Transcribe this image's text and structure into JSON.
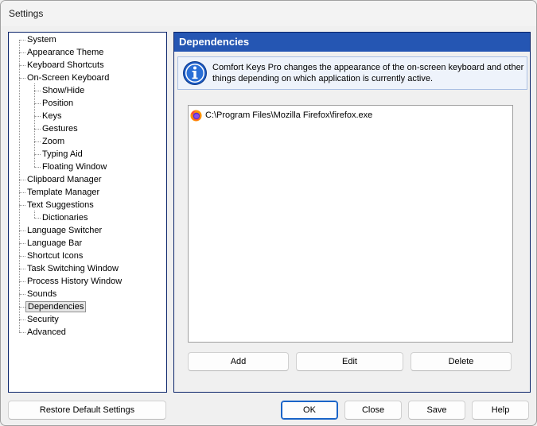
{
  "window": {
    "title": "Settings"
  },
  "tree": {
    "items": [
      {
        "label": "System",
        "level": 0
      },
      {
        "label": "Appearance Theme",
        "level": 0
      },
      {
        "label": "Keyboard Shortcuts",
        "level": 0
      },
      {
        "label": "On-Screen Keyboard",
        "level": 0
      },
      {
        "label": "Show/Hide",
        "level": 1
      },
      {
        "label": "Position",
        "level": 1
      },
      {
        "label": "Keys",
        "level": 1
      },
      {
        "label": "Gestures",
        "level": 1
      },
      {
        "label": "Zoom",
        "level": 1
      },
      {
        "label": "Typing Aid",
        "level": 1
      },
      {
        "label": "Floating Window",
        "level": 1
      },
      {
        "label": "Clipboard Manager",
        "level": 0
      },
      {
        "label": "Template Manager",
        "level": 0
      },
      {
        "label": "Text Suggestions",
        "level": 0
      },
      {
        "label": "Dictionaries",
        "level": 1
      },
      {
        "label": "Language Switcher",
        "level": 0
      },
      {
        "label": "Language Bar",
        "level": 0
      },
      {
        "label": "Shortcut Icons",
        "level": 0
      },
      {
        "label": "Task Switching Window",
        "level": 0
      },
      {
        "label": "Process History Window",
        "level": 0
      },
      {
        "label": "Sounds",
        "level": 0
      },
      {
        "label": "Dependencies",
        "level": 0,
        "selected": true
      },
      {
        "label": "Security",
        "level": 0
      },
      {
        "label": "Advanced",
        "level": 0
      }
    ]
  },
  "panel": {
    "header": "Dependencies",
    "info_text": "Comfort Keys Pro changes the appearance of the on-screen keyboard and other things depending on which application is currently active.",
    "list_items": [
      {
        "icon": "firefox-icon",
        "path": "C:\\Program Files\\Mozilla Firefox\\firefox.exe"
      }
    ],
    "buttons": {
      "add": "Add",
      "edit": "Edit",
      "delete": "Delete"
    }
  },
  "footer": {
    "restore": "Restore Default Settings",
    "ok": "OK",
    "close": "Close",
    "save": "Save",
    "help": "Help"
  },
  "colors": {
    "header_bg": "#2556b3",
    "info_bg": "#eef3fb",
    "border_dark": "#0a246a"
  }
}
